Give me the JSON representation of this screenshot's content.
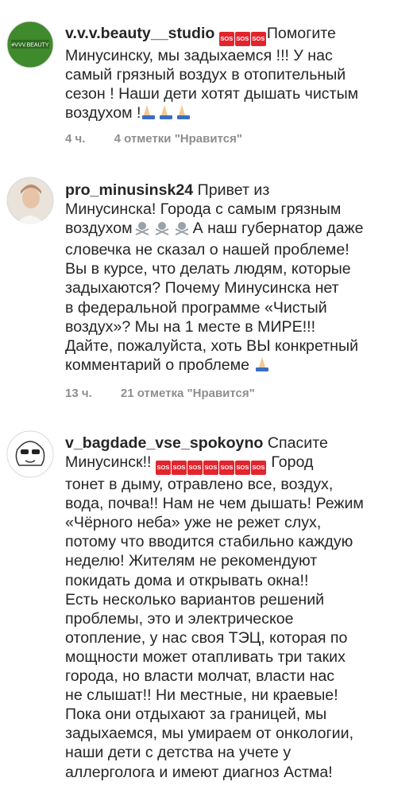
{
  "comments": [
    {
      "username": "v.v.v.beauty__studio",
      "avatar_text": "#VVV.BEAUTY",
      "lines_after_name": [
        "Помогите"
      ],
      "lines": [
        "Минусинску, мы задыхаемся !!! У нас",
        "самый грязный воздух в отопительный",
        "сезон ! Наши дети хотят дышать чистым",
        "воздухом !"
      ],
      "time": "4 ч.",
      "likes": "4 отметки \"Нравится\""
    },
    {
      "username": "pro_minusinsk24",
      "first_line_text": "Привет из",
      "lines": [
        "Минусинска! Города с самым грязным",
        "воздухом",
        "словечка не сказал о нашей проблеме!",
        "Вы в курсе, что делать людям, которые",
        "задыхаются? Почему Минусинска нет",
        "в федеральной программе «Чистый",
        "воздух»? Мы на 1 месте в МИРЕ!!!",
        "Дайте, пожалуйста, хоть ВЫ конкретный",
        "комментарий о проблеме"
      ],
      "line2_suffix": "А наш губернатор даже",
      "time": "13 ч.",
      "likes": "21 отметка \"Нравится\""
    },
    {
      "username": "v_bagdade_vse_spokoyno",
      "first_line_text": "Спасите",
      "line1_start": "Минусинск!!",
      "line1_end": "Город",
      "lines": [
        "тонет в дыму, отравлено все, воздух,",
        "вода, почва!! Нам не чем дышать! Режим",
        "«Чёрного неба» уже не режет слух,",
        "потому что вводится стабильно каждую",
        "неделю! Жителям не рекомендуют",
        "покидать дома и открывать окна!!",
        "Есть несколько вариантов решений",
        "проблемы, это и электрическое",
        "отопление, у нас своя ТЭЦ, которая по",
        "мощности может отапливать три таких",
        "города, но власти молчат, власти нас",
        "не слышат!! Ни местные, ни краевые!",
        "Пока они отдыхают за границей, мы",
        "задыхаемся, мы умираем от онкологии,",
        "наши дети с детства на учете у",
        "аллерголога и имеют диагноз  Астма!"
      ]
    }
  ],
  "sos_label": "SOS",
  "colors": {
    "sos_red": "#e4242c",
    "meta_gray": "#8e8e8e",
    "text": "#262626"
  }
}
